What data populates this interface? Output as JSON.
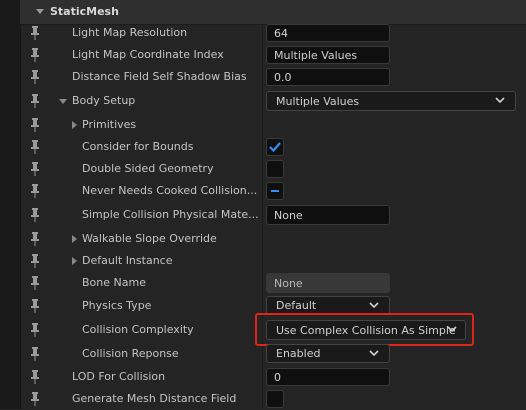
{
  "section": {
    "title": "StaticMesh"
  },
  "rows": {
    "light_map_resolution": {
      "label": "Light Map Resolution",
      "value": "64"
    },
    "light_map_coordinate_index": {
      "label": "Light Map Coordinate Index",
      "value": "Multiple Values"
    },
    "distance_field_self_shadow_bias": {
      "label": "Distance Field Self Shadow Bias",
      "value": "0.0"
    },
    "body_setup": {
      "label": "Body Setup",
      "value": "Multiple Values"
    },
    "primitives": {
      "label": "Primitives"
    },
    "consider_for_bounds": {
      "label": "Consider for Bounds",
      "state": "checked"
    },
    "double_sided_geometry": {
      "label": "Double Sided Geometry",
      "state": "unchecked"
    },
    "never_needs_cooked_collision": {
      "label": "Never Needs Cooked Collision...",
      "state": "mixed"
    },
    "simple_collision_physical_material": {
      "label": "Simple Collision Physical Mate...",
      "value": "None"
    },
    "walkable_slope_override": {
      "label": "Walkable Slope Override"
    },
    "default_instance": {
      "label": "Default Instance"
    },
    "bone_name": {
      "label": "Bone Name",
      "value": "None"
    },
    "physics_type": {
      "label": "Physics Type",
      "value": "Default"
    },
    "collision_complexity": {
      "label": "Collision Complexity",
      "value": "Use Complex Collision As Simple"
    },
    "collision_reponse": {
      "label": "Collision Reponse",
      "value": "Enabled"
    },
    "lod_for_collision": {
      "label": "LOD For Collision",
      "value": "0"
    },
    "generate_mesh_distance_field": {
      "label": "Generate Mesh Distance Field",
      "state": "unchecked"
    }
  },
  "colors": {
    "accent": "#2f8ff5",
    "highlight": "#e0231a",
    "background": "#242424"
  }
}
